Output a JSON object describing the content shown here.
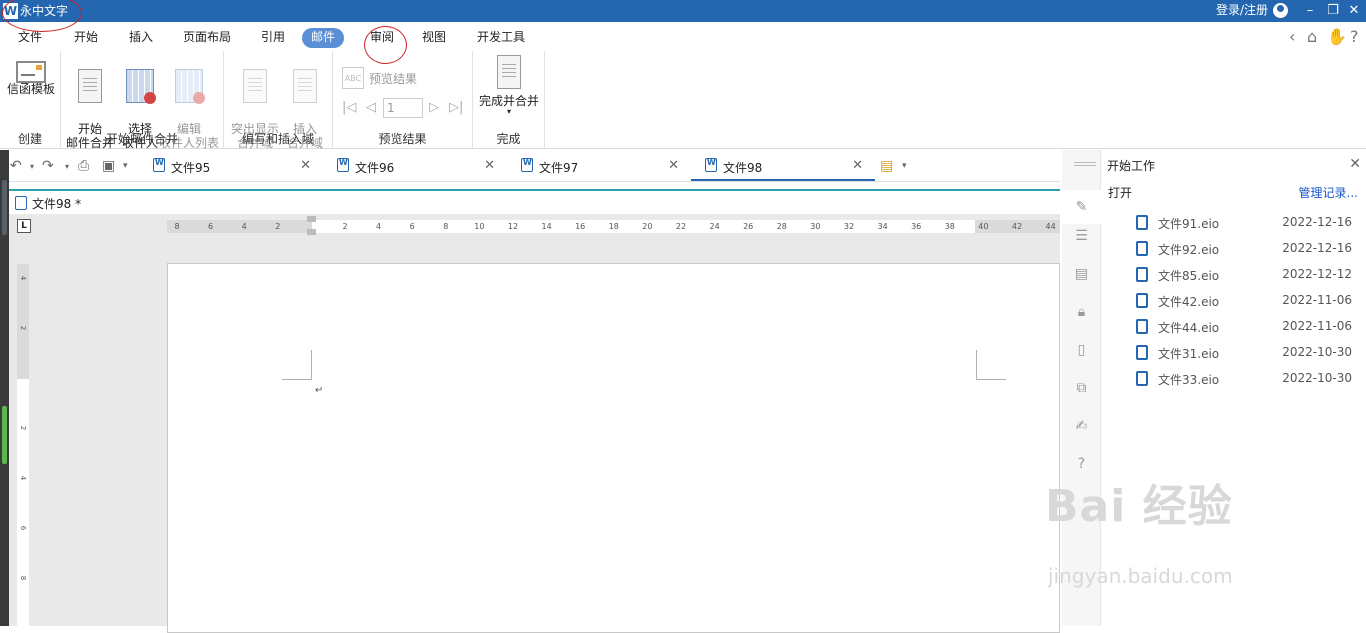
{
  "titlebar": {
    "logo": "W",
    "app_title": "永中文字",
    "login": "登录/注册",
    "minimize": "–",
    "restore": "❐",
    "close": "✕"
  },
  "menu": {
    "items": [
      "文件",
      "开始",
      "插入",
      "页面布局",
      "引用",
      "邮件",
      "审阅",
      "视图",
      "开发工具"
    ],
    "active": "邮件",
    "controls": [
      "‹",
      "⌂",
      "✋",
      "?"
    ]
  },
  "ribbon": {
    "groups": [
      {
        "name": "创建",
        "buttons": [
          "信函模板"
        ]
      },
      {
        "name": "开始邮件合并",
        "buttons": [
          "开始\n邮件合并",
          "选择\n收件人",
          "编辑\n收件人列表"
        ]
      },
      {
        "name": "编写和插入域",
        "buttons": [
          "突出显示\n合并域",
          "插入\n合并域"
        ]
      },
      {
        "name": "预览结果",
        "buttons": [
          "预览结果"
        ],
        "record_value": "1"
      },
      {
        "name": "完成",
        "buttons": [
          "完成并合并"
        ]
      }
    ]
  },
  "tabs": [
    {
      "label": "文件95",
      "active": false
    },
    {
      "label": "文件96",
      "active": false
    },
    {
      "label": "文件97",
      "active": false
    },
    {
      "label": "文件98",
      "active": true
    }
  ],
  "document": {
    "name": "文件98 *",
    "ruler_corner": "L",
    "ruler_h_ticks": [
      "8",
      "6",
      "4",
      "2",
      "2",
      "4",
      "6",
      "8",
      "10",
      "12",
      "14",
      "16",
      "18",
      "20",
      "22",
      "24",
      "26",
      "28",
      "30",
      "32",
      "34",
      "36",
      "38",
      "40",
      "42",
      "44"
    ],
    "ruler_v_ticks": [
      "4",
      "2",
      "2",
      "4",
      "6",
      "8"
    ],
    "return_mark": "↵"
  },
  "sidebar": {
    "title": "开始工作",
    "open_label": "打开",
    "manage_label": "管理记录...",
    "recent": [
      {
        "name": "文件91.eio",
        "date": "2022-12-16"
      },
      {
        "name": "文件92.eio",
        "date": "2022-12-16"
      },
      {
        "name": "文件85.eio",
        "date": "2022-12-12"
      },
      {
        "name": "文件42.eio",
        "date": "2022-11-06"
      },
      {
        "name": "文件44.eio",
        "date": "2022-11-06"
      },
      {
        "name": "文件31.eio",
        "date": "2022-10-30"
      },
      {
        "name": "文件33.eio",
        "date": "2022-10-30"
      }
    ],
    "icons": [
      "pencil-icon",
      "settings-icon",
      "styles-icon",
      "lock-icon",
      "clip-icon",
      "copy-icon",
      "edit-icon",
      "help-icon"
    ]
  },
  "watermark": {
    "line1": "Bai 经验",
    "line2": "jingyan.baidu.com"
  },
  "colors": {
    "titlebar": "#2467b0",
    "active_tab": "#5b8fd5",
    "link": "#1a55c8"
  }
}
